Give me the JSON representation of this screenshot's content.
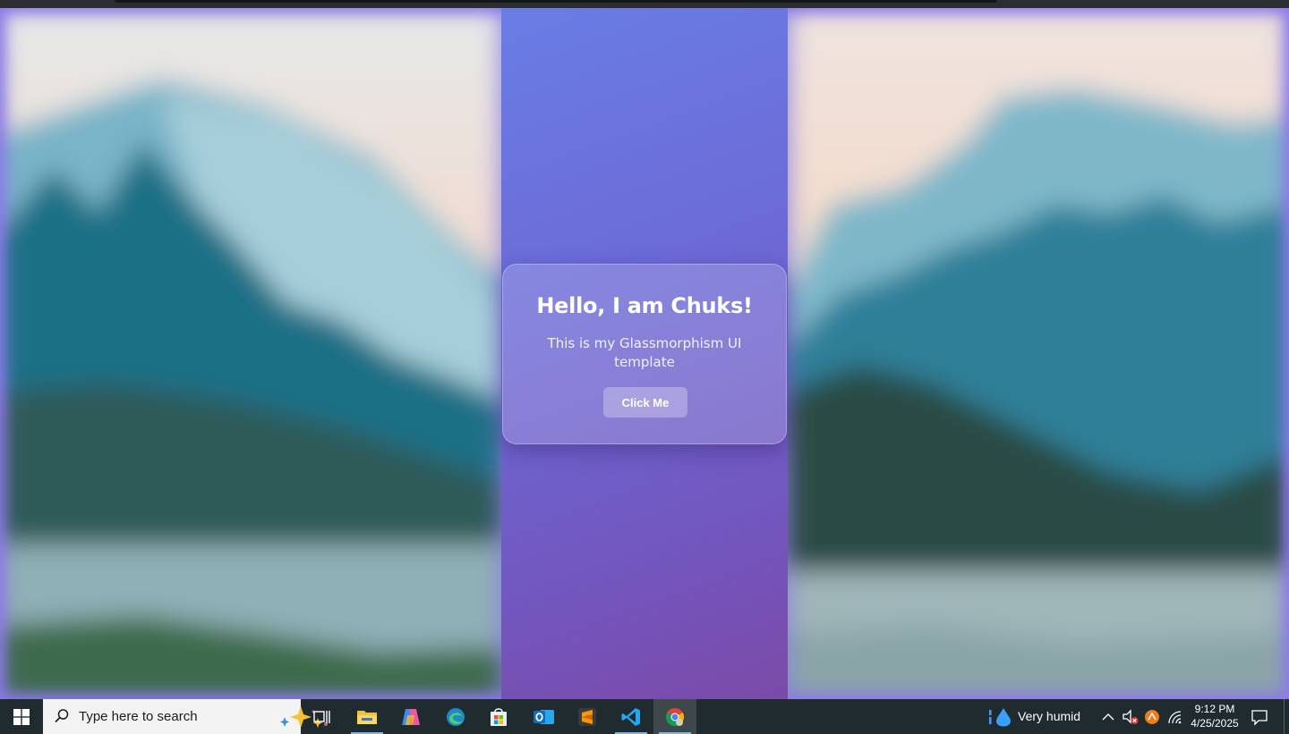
{
  "card": {
    "title": "Hello, I am Chuks!",
    "text": "This is my Glassmorphism UI template",
    "button_label": "Click Me"
  },
  "taskbar": {
    "search_placeholder": "Type here to search",
    "apps": [
      "task-view",
      "file-explorer",
      "copilot",
      "edge",
      "microsoft-store",
      "outlook",
      "sublime-text",
      "vscode",
      "chrome"
    ],
    "weather": "Very humid",
    "time": "9:12 PM",
    "date": "4/25/2025"
  },
  "colors": {
    "gradient_top": "#6a7de6",
    "gradient_bottom": "#7b4aa8",
    "taskbar": "#1f2b2e",
    "accent": "#76b9ed"
  }
}
